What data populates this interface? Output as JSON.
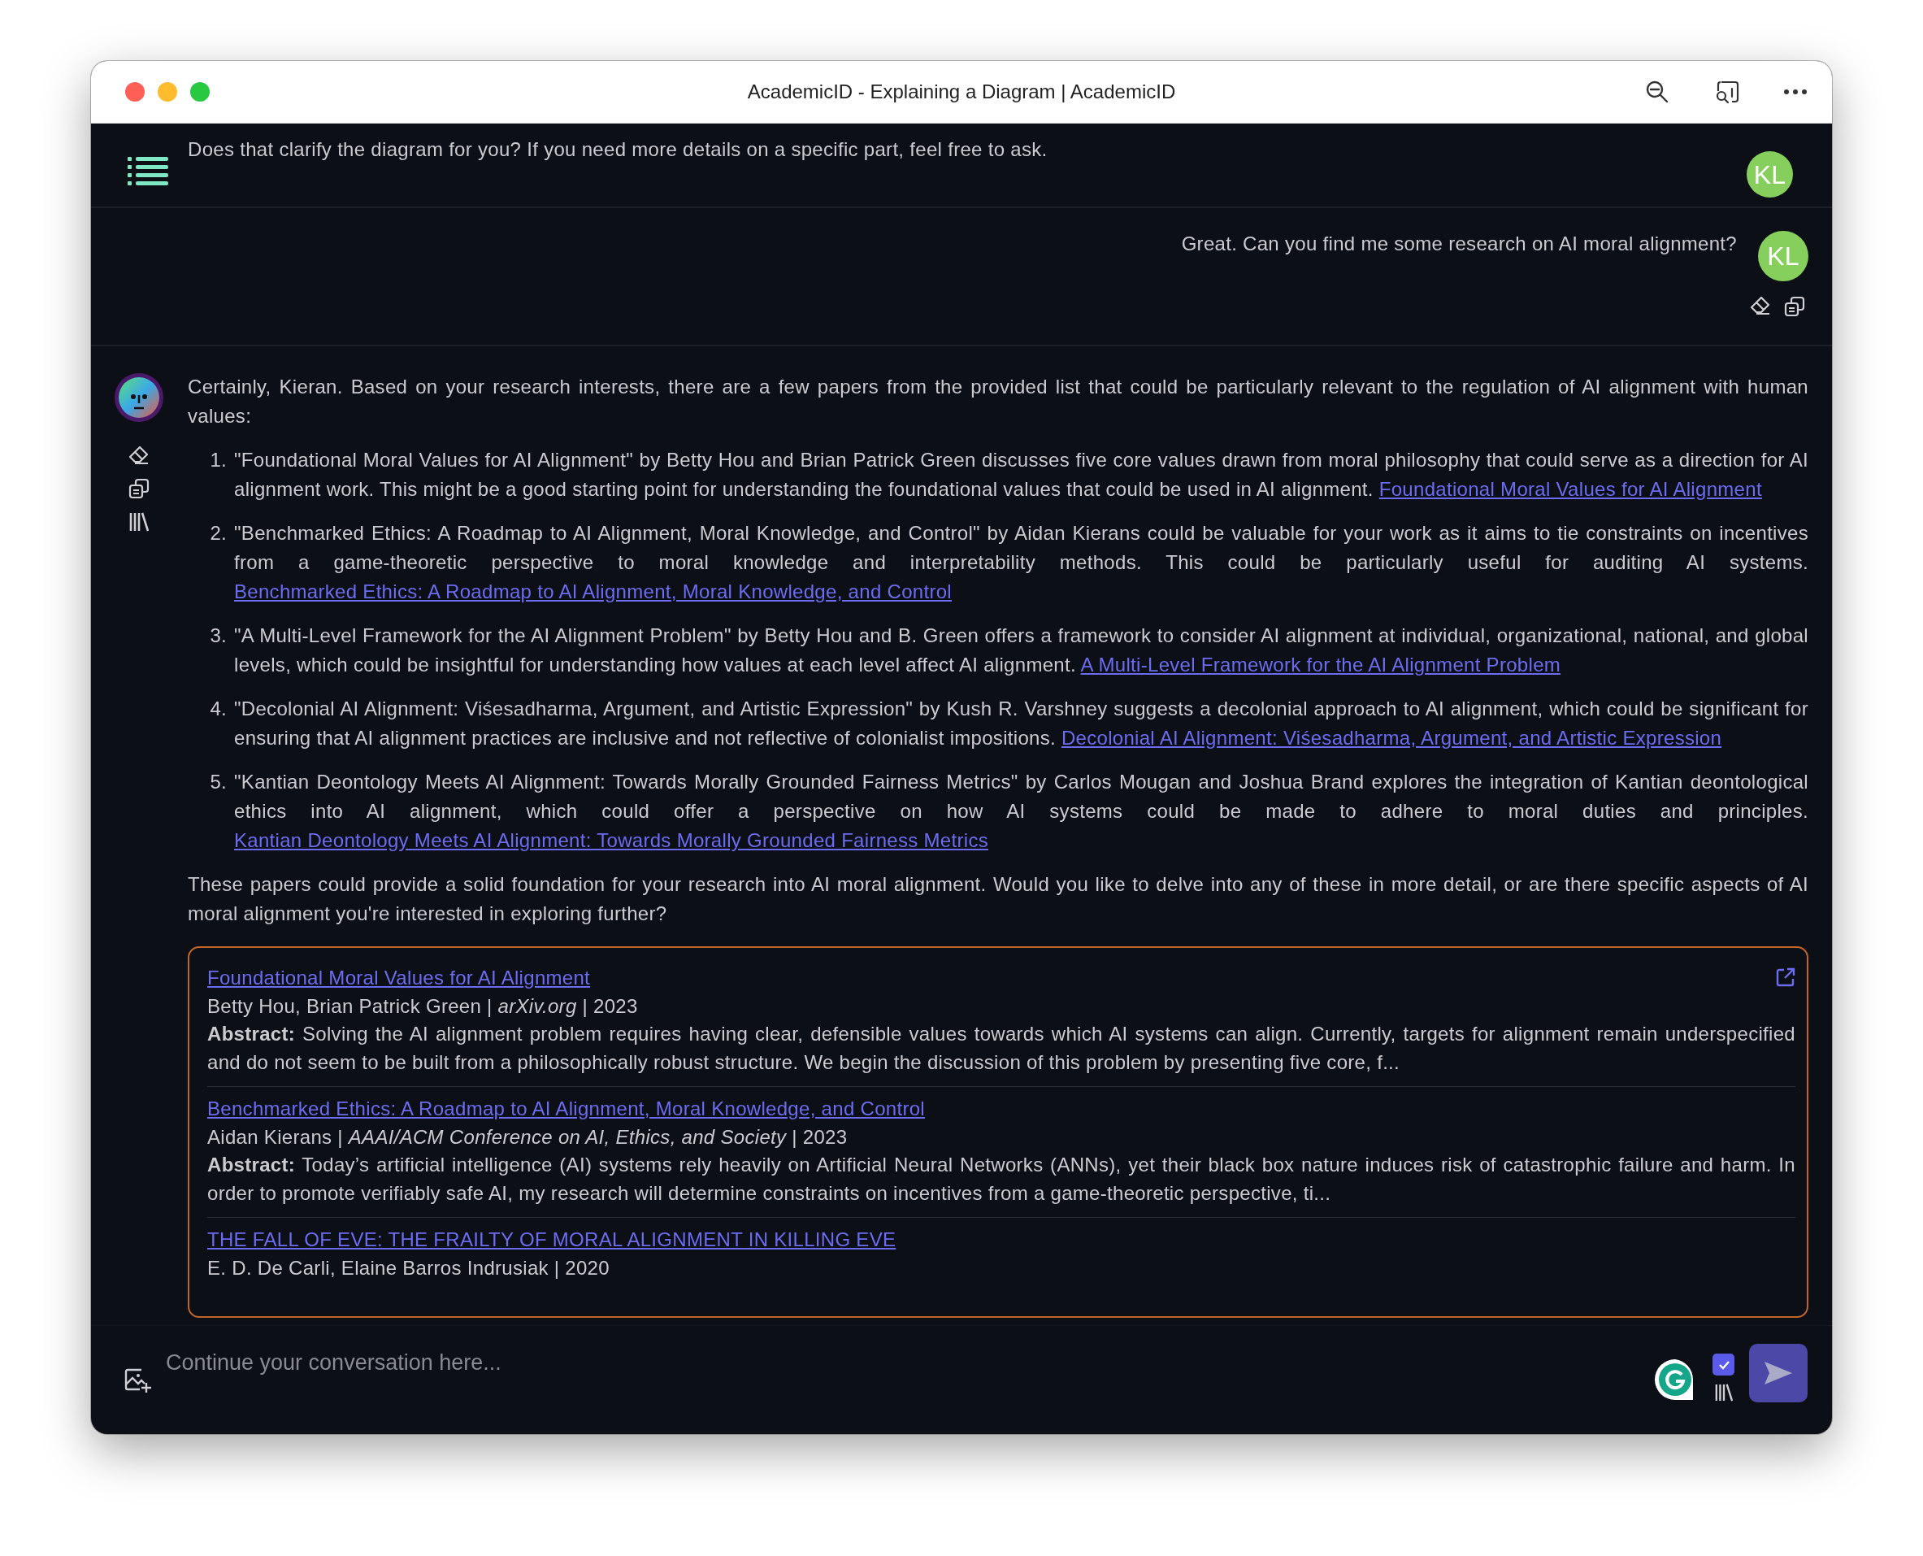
{
  "window": {
    "title": "AcademicID - Explaining a Diagram | AcademicID"
  },
  "messages": [
    {
      "kind": "assistant_tail",
      "text": "Does that clarify the diagram for you? If you need more details on a specific part, feel free to ask.",
      "avatar": "KL"
    },
    {
      "kind": "user",
      "text": "Great. Can you find me some research on AI moral alignment?",
      "avatar": "KL"
    },
    {
      "kind": "assistant",
      "intro": "Certainly, Kieran. Based on your research interests, there are a few papers from the provided list that could be particularly relevant to the regulation of AI alignment with human values:",
      "items": [
        {
          "number": "1.",
          "text": "\"Foundational Moral Values for AI Alignment\" by Betty Hou and Brian Patrick Green discusses five core values drawn from moral philosophy that could serve as a direction for AI alignment work. This might be a good starting point for understanding the foundational values that could be used in AI alignment.",
          "link": "Foundational Moral Values for AI Alignment"
        },
        {
          "number": "2.",
          "text": "\"Benchmarked Ethics: A Roadmap to AI Alignment, Moral Knowledge, and Control\" by Aidan Kierans could be valuable for your work as it aims to tie constraints on incentives from a game-theoretic perspective to moral knowledge and interpretability methods. This could be particularly useful for auditing AI systems.",
          "link": "Benchmarked Ethics: A Roadmap to AI Alignment, Moral Knowledge, and Control"
        },
        {
          "number": "3.",
          "text": "\"A Multi-Level Framework for the AI Alignment Problem\" by Betty Hou and B. Green offers a framework to consider AI alignment at individual, organizational, national, and global levels, which could be insightful for understanding how values at each level affect AI alignment.",
          "link": "A Multi-Level Framework for the AI Alignment Problem"
        },
        {
          "number": "4.",
          "text": "\"Decolonial AI Alignment: Viśesadharma, Argument, and Artistic Expression\" by Kush R. Varshney suggests a decolonial approach to AI alignment, which could be significant for ensuring that AI alignment practices are inclusive and not reflective of colonialist impositions.",
          "link": "Decolonial AI Alignment: Viśesadharma, Argument, and Artistic Expression"
        },
        {
          "number": "5.",
          "text": "\"Kantian Deontology Meets AI Alignment: Towards Morally Grounded Fairness Metrics\" by Carlos Mougan and Joshua Brand explores the integration of Kantian deontological ethics into AI alignment, which could offer a perspective on how AI systems could be made to adhere to moral duties and principles.",
          "link": "Kantian Deontology Meets AI Alignment: Towards Morally Grounded Fairness Metrics"
        }
      ],
      "outro": "These papers could provide a solid foundation for your research into AI moral alignment. Would you like to delve into any of these in more detail, or are there specific aspects of AI moral alignment you're interested in exploring further?",
      "papers": [
        {
          "title": "Foundational Moral Values for AI Alignment",
          "meta": "Betty Hou, Brian Patrick Green | *arXiv.org* | 2023",
          "abstract": "**Abstract:** Solving the AI alignment problem requires having clear, defensible values towards which AI systems can align. Currently, targets for alignment remain underspecified and do not seem to be built from a philosophically robust structure. We begin the discussion of this problem by presenting five core, f..."
        },
        {
          "title": "Benchmarked Ethics: A Roadmap to AI Alignment, Moral Knowledge, and Control",
          "meta": "Aidan Kierans | *AAAI/ACM Conference on AI, Ethics, and Society* | 2023",
          "abstract": "**Abstract:** Today’s artificial intelligence (AI) systems rely heavily on Artificial Neural Networks (ANNs), yet their black box nature induces risk of catastrophic failure and harm. In order to promote verifiably safe AI, my research will determine constraints on incentives from a game-theoretic perspective, ti..."
        },
        {
          "title": "THE FALL OF EVE: THE FRAILTY OF MORAL ALIGNMENT IN KILLING EVE",
          "meta": "E. D. De Carli, Elaine Barros Indrusiak | 2020"
        }
      ]
    }
  ],
  "composer": {
    "placeholder": "Continue your conversation here...",
    "library_checked": true
  }
}
